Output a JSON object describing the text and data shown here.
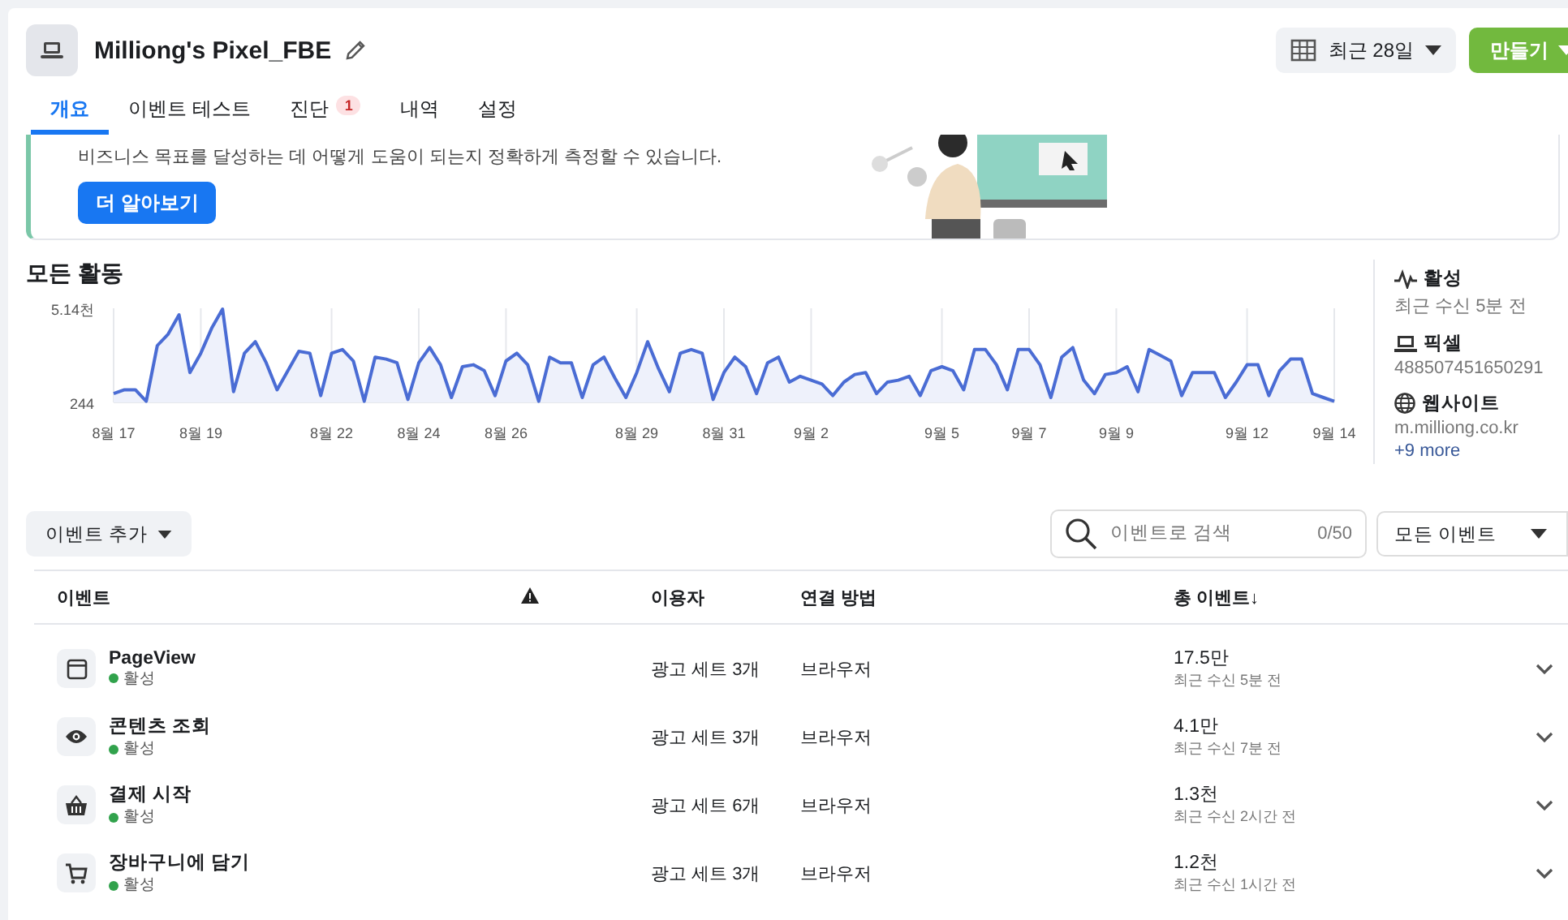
{
  "header": {
    "title": "Milliong's Pixel_FBE",
    "date_range": "최근 28일",
    "create_button": "만들기"
  },
  "tabs": [
    {
      "label": "개요",
      "selected": true
    },
    {
      "label": "이벤트 테스트",
      "selected": false
    },
    {
      "label": "진단",
      "selected": false,
      "badge": "1"
    },
    {
      "label": "내역",
      "selected": false
    },
    {
      "label": "설정",
      "selected": false
    }
  ],
  "banner": {
    "text": "비즈니스 목표를 달성하는 데 어떻게 도움이 되는지 정확하게 측정할 수 있습니다.",
    "button": "더 알아보기"
  },
  "activity": {
    "title": "모든 활동",
    "y_labels": [
      "5.14천",
      "244"
    ],
    "x_labels": [
      "8월 17",
      "8월 19",
      "8월 22",
      "8월 24",
      "8월 26",
      "8월 29",
      "8월 31",
      "9월 2",
      "9월 5",
      "9월 7",
      "9월 9",
      "9월 12",
      "9월 14"
    ]
  },
  "summary": [
    {
      "kind": "status",
      "label": "활성",
      "value": "최근 수신 5분 전"
    },
    {
      "kind": "pixel",
      "label": "픽셀",
      "value": "488507451650291"
    },
    {
      "kind": "website",
      "label": "웹사이트",
      "value": "m.milliong.co.kr",
      "link": "+9 more"
    }
  ],
  "toolbar": {
    "add_button": "이벤트 추가",
    "search": {
      "placeholder": "이벤트로 검색",
      "counter": "0/50"
    },
    "filter": "모든 이벤트"
  },
  "table": {
    "columns": [
      "이벤트",
      "이용자",
      "연결 방법",
      "총 이벤트↓"
    ],
    "rows": [
      {
        "kind": "page",
        "name": "PageView",
        "status": "활성",
        "users": "광고 세트 3개",
        "method": "브라우저",
        "total": "17.5만",
        "received": "최근 수신 5분 전"
      },
      {
        "kind": "view",
        "name": "콘텐츠 조회",
        "status": "활성",
        "users": "광고 세트 3개",
        "method": "브라우저",
        "total": "4.1만",
        "received": "최근 수신 7분 전"
      },
      {
        "kind": "checkout",
        "name": "결제 시작",
        "status": "활성",
        "users": "광고 세트 6개",
        "method": "브라우저",
        "total": "1.3천",
        "received": "최근 수신 2시간 전"
      },
      {
        "kind": "cart",
        "name": "장바구니에 담기",
        "status": "활성",
        "users": "광고 세트 3개",
        "method": "브라우저",
        "total": "1.2천",
        "received": "최근 수신 1시간 전"
      }
    ]
  }
}
